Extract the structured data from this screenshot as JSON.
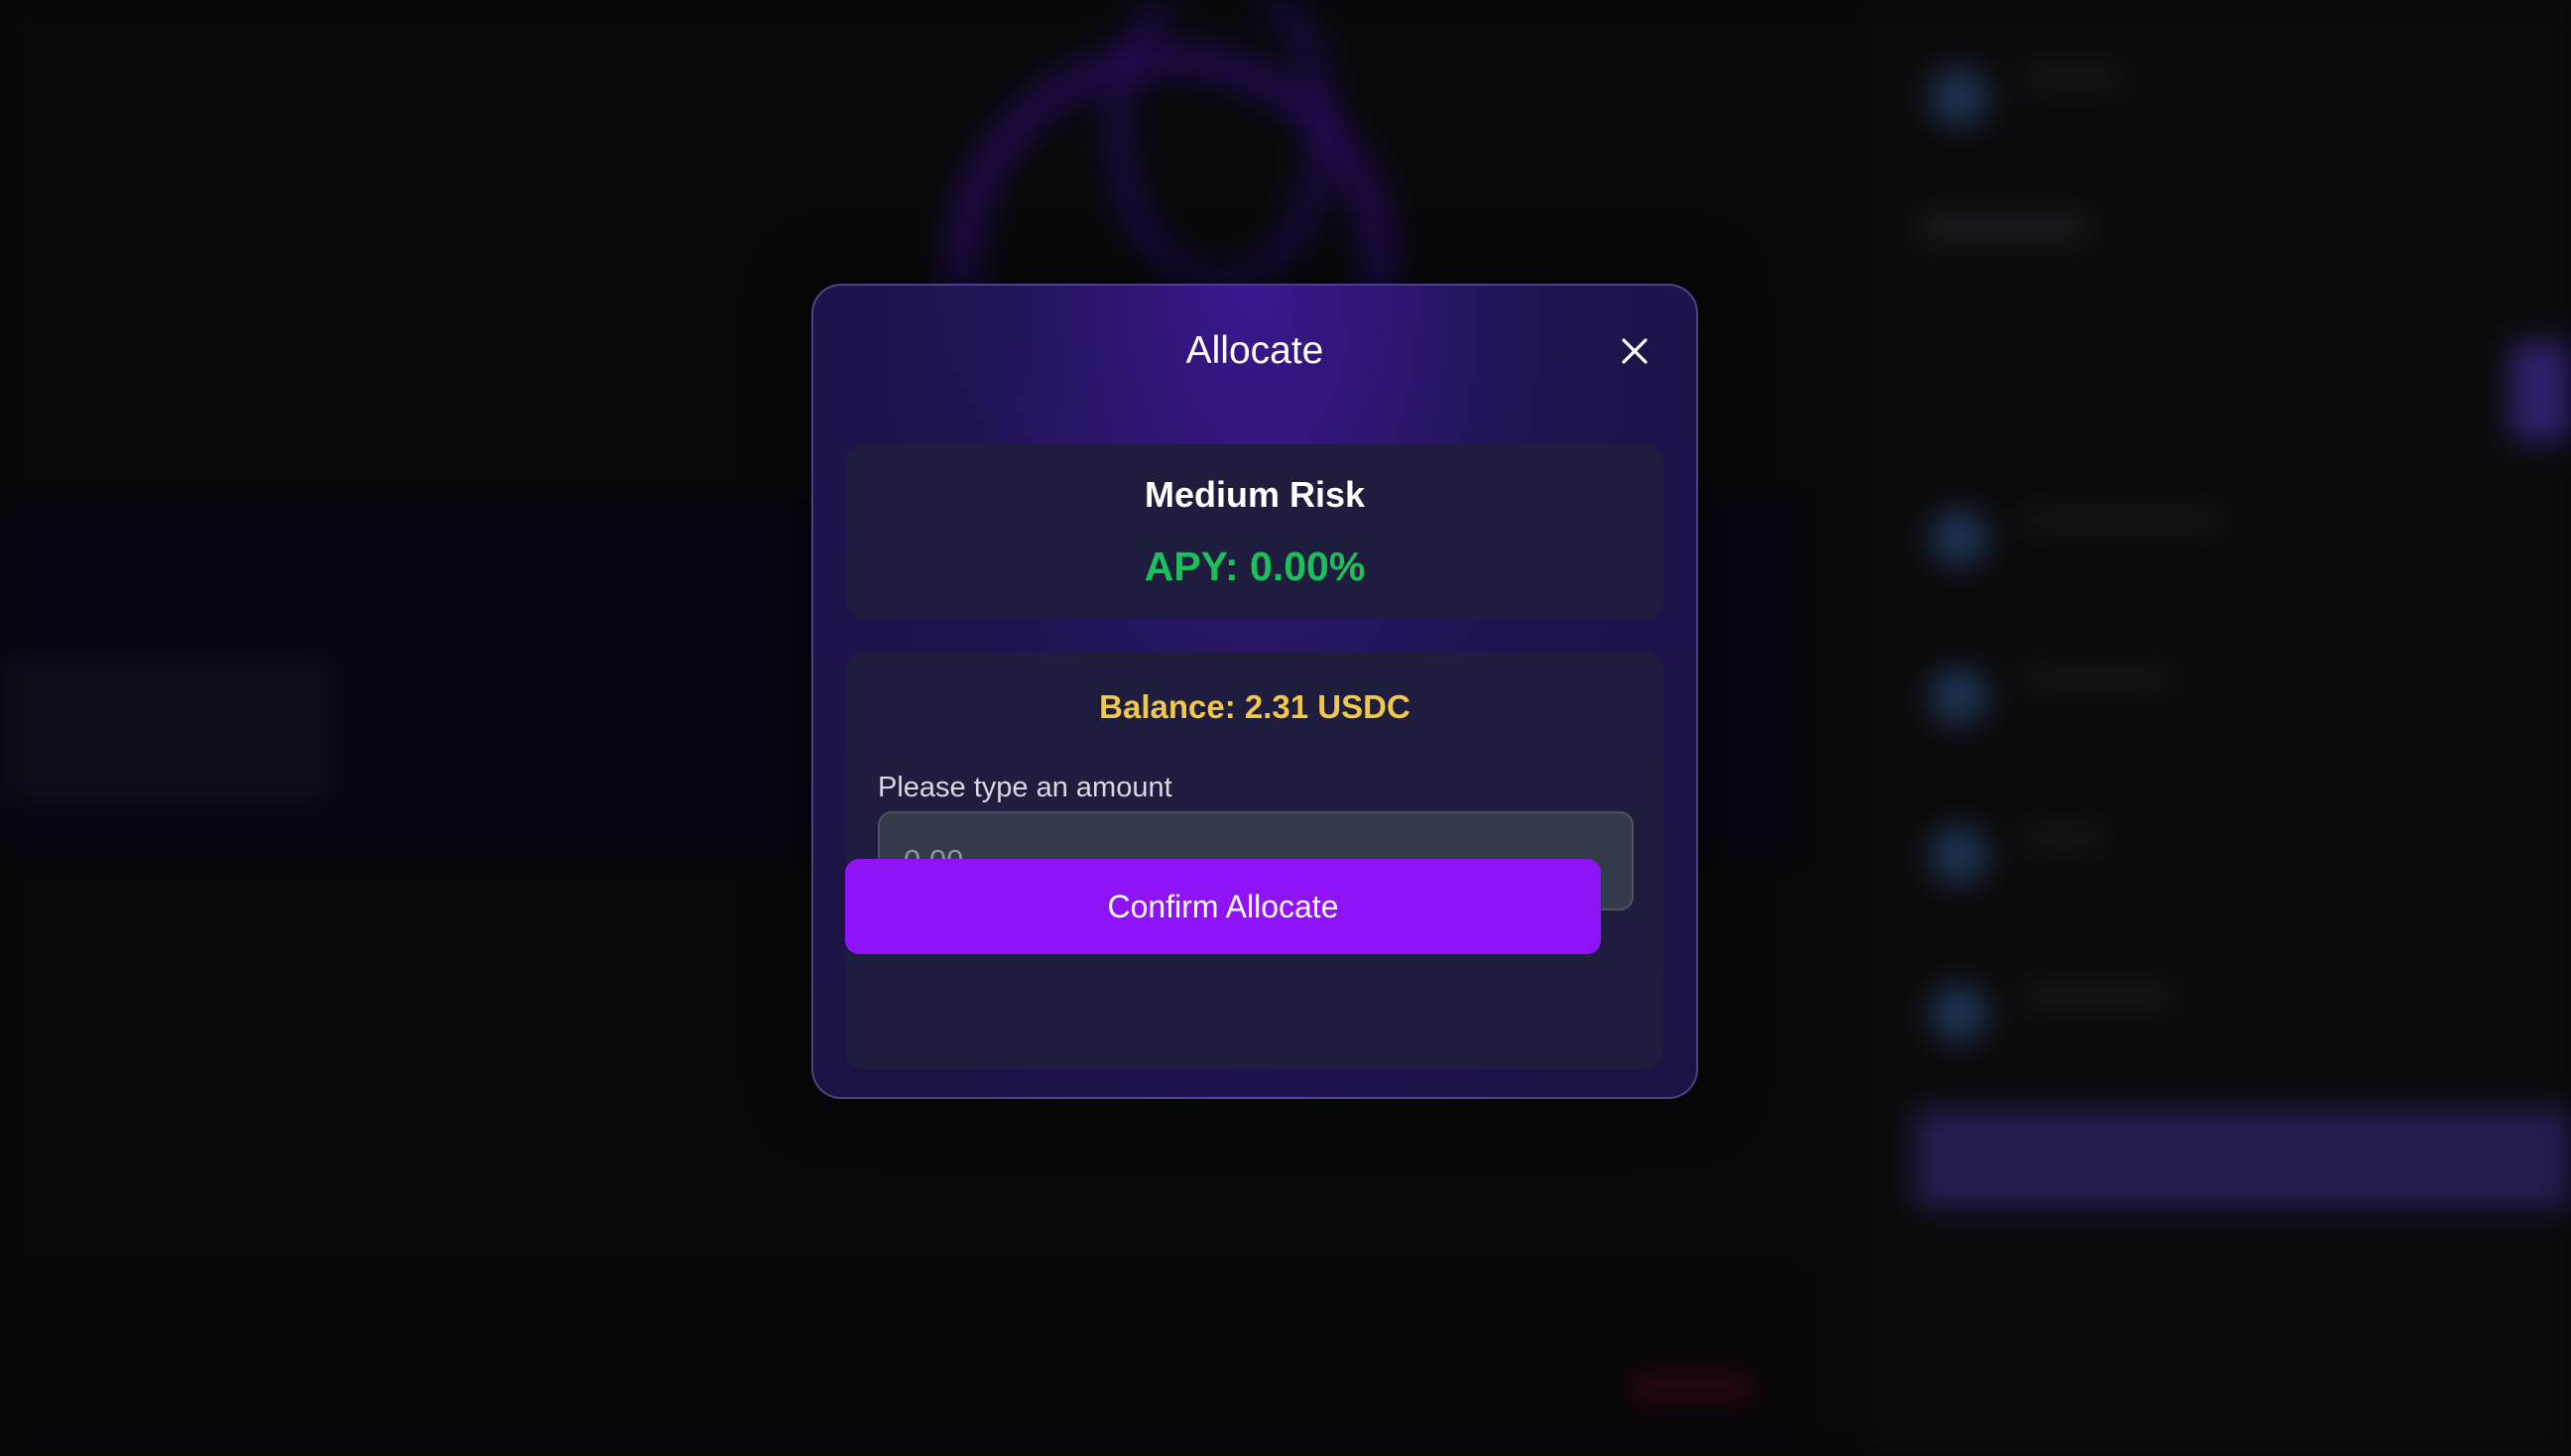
{
  "modal": {
    "title": "Allocate",
    "close_icon": "close-icon"
  },
  "strategy": {
    "risk_label": "Medium Risk",
    "apy_text": "APY: 0.00%"
  },
  "form": {
    "balance_text": "Balance: 2.31 USDC",
    "amount_label": "Please type an amount",
    "amount_value": "",
    "amount_placeholder": "0.00",
    "confirm_label": "Confirm Allocate"
  },
  "colors": {
    "apy_green": "#1cc05a",
    "balance_yellow": "#f2c84b",
    "confirm_purple": "#8e14f7",
    "card_bg": "#1e1d3e"
  }
}
